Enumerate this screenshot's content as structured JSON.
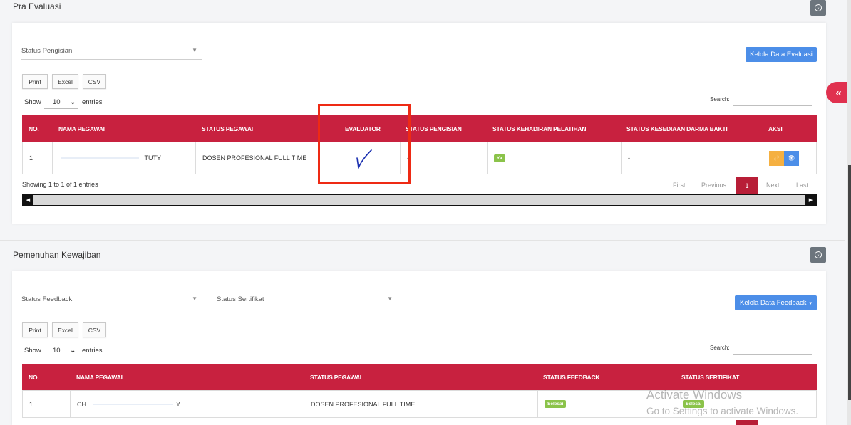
{
  "pra_evaluasi": {
    "title": "Pra Evaluasi",
    "filter_status_pengisian": "Status Pengisian",
    "kelola_button": "Kelola Data Evaluasi",
    "buttons": {
      "print": "Print",
      "excel": "Excel",
      "csv": "CSV"
    },
    "show_label": "Show",
    "entries_value": "10",
    "entries_label": "entries",
    "search_label": "Search:",
    "columns": [
      "NO.",
      "NAMA PEGAWAI",
      "STATUS PEGAWAI",
      "EVALUATOR",
      "STATUS PENGISIAN",
      "STATUS KEHADIRAN PELATIHAN",
      "STATUS KESEDIAAN DARMA BAKTI",
      "AKSI"
    ],
    "rows": [
      {
        "no": "1",
        "nama": "TUTY",
        "status_pegawai": "DOSEN PROFESIONAL FULL TIME",
        "evaluator": "",
        "status_pengisian": "-",
        "kehadiran": "Ya",
        "darma_bakti": "-"
      }
    ],
    "info": "Showing 1 to 1 of 1 entries",
    "pagination": {
      "first": "First",
      "previous": "Previous",
      "current": "1",
      "next": "Next",
      "last": "Last"
    }
  },
  "pemenuhan_kewajiban": {
    "title": "Pemenuhan Kewajiban",
    "filter_status_feedback": "Status Feedback",
    "filter_status_sertifikat": "Status Sertifikat",
    "kelola_button": "Kelola Data Feedback",
    "buttons": {
      "print": "Print",
      "excel": "Excel",
      "csv": "CSV"
    },
    "show_label": "Show",
    "entries_value": "10",
    "entries_label": "entries",
    "search_label": "Search:",
    "columns": [
      "NO.",
      "NAMA PEGAWAI",
      "STATUS PEGAWAI",
      "STATUS FEEDBACK",
      "STATUS SERTIFIKAT"
    ],
    "rows": [
      {
        "no": "1",
        "nama_start": "CH",
        "nama_end": "Y",
        "status_pegawai": "DOSEN PROFESIONAL FULL TIME",
        "feedback": "Selesai",
        "sertifikat": "Selesai"
      }
    ]
  },
  "sidebar_toggle": "«",
  "watermark": {
    "line1": "Activate Windows",
    "line2": "Go to Settings to activate Windows."
  },
  "colors": {
    "table_header": "#c8213f",
    "primary": "#4c8ee8",
    "badge": "#8bc34a",
    "highlight": "#ee2a14"
  }
}
